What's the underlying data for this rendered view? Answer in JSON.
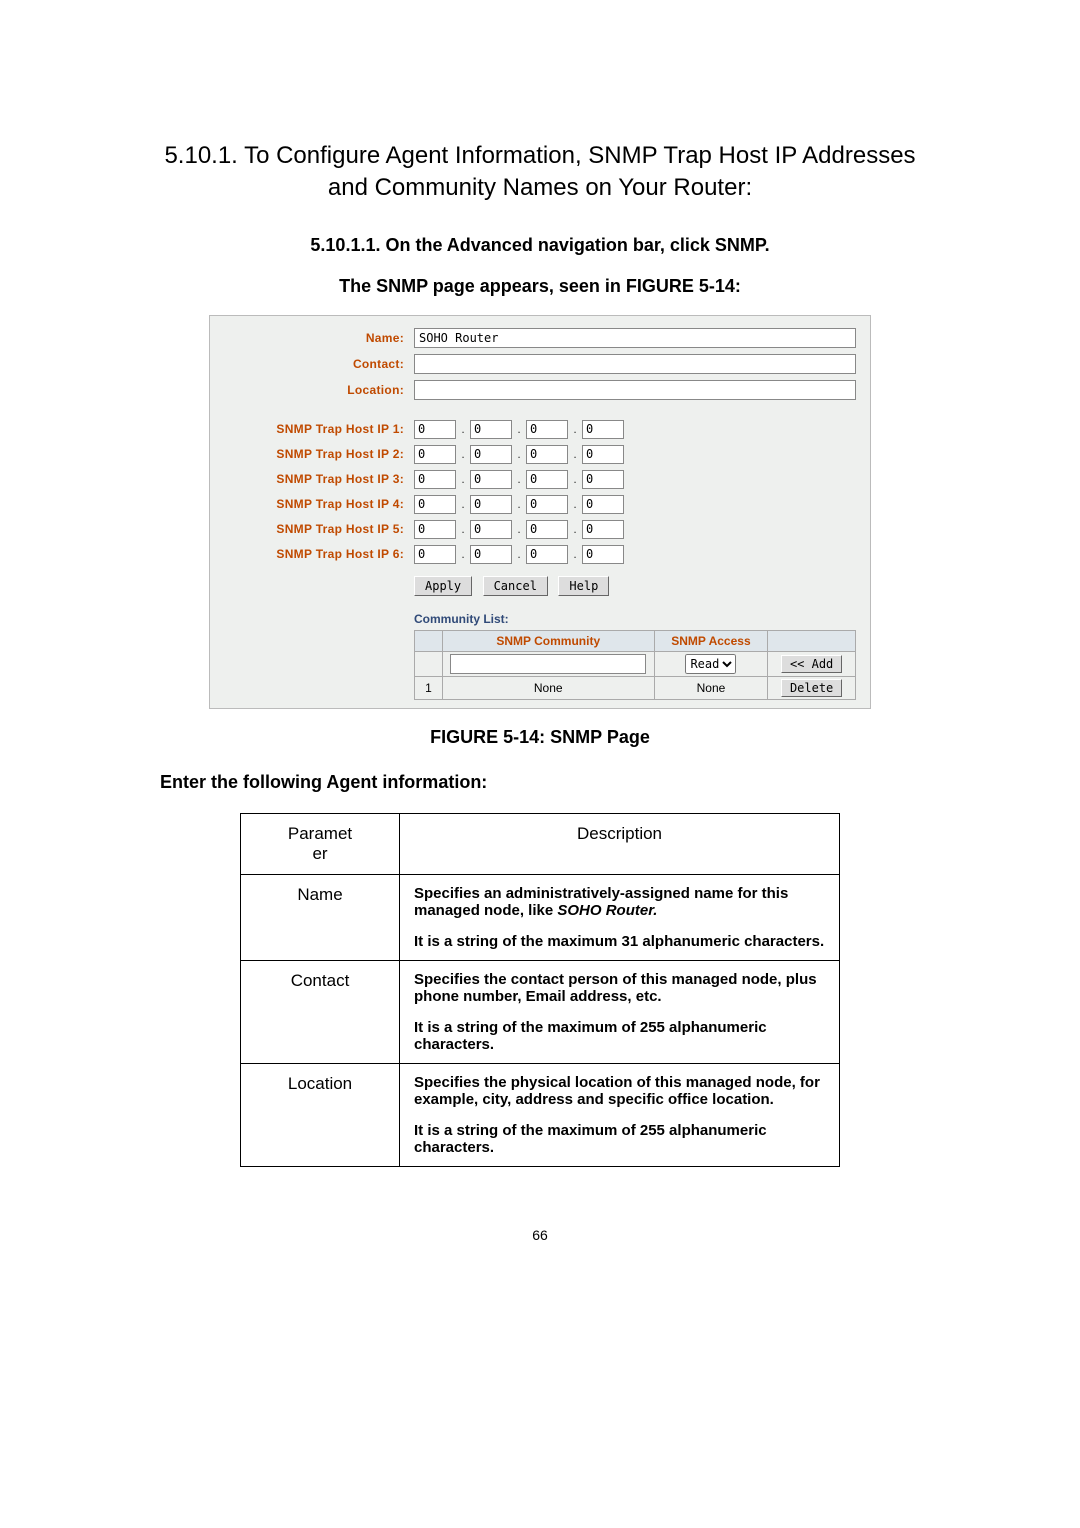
{
  "headings": {
    "section": "5.10.1. To Configure Agent Information, SNMP Trap Host IP Addresses and Community Names on Your Router:",
    "step": "5.10.1.1. On the Advanced navigation bar, click SNMP.",
    "result": "The SNMP page appears, seen in FIGURE 5-14:"
  },
  "snmp_page": {
    "labels": {
      "name": "Name:",
      "contact": "Contact:",
      "location": "Location:",
      "trap1": "SNMP Trap Host IP 1:",
      "trap2": "SNMP Trap Host IP 2:",
      "trap3": "SNMP Trap Host IP 3:",
      "trap4": "SNMP Trap Host IP 4:",
      "trap5": "SNMP Trap Host IP 5:",
      "trap6": "SNMP Trap Host IP 6:"
    },
    "fields": {
      "name_value": "SOHO Router",
      "contact_value": "",
      "location_value": "",
      "octet": "0"
    },
    "buttons": {
      "apply": "Apply",
      "cancel": "Cancel",
      "help": "Help"
    },
    "community": {
      "title": "Community List:",
      "col_community": "SNMP Community",
      "col_access": "SNMP Access",
      "access_selected": "Read",
      "add_btn": "<< Add",
      "row1_num": "1",
      "row1_comm": "None",
      "row1_access": "None",
      "delete_btn": "Delete"
    }
  },
  "figure_caption": "FIGURE 5-14: SNMP Page",
  "enter_info": "Enter the following Agent information:",
  "desc_table": {
    "header_param": "Paramet­er",
    "header_param_l1": "Paramet",
    "header_param_l2": "er",
    "header_desc": "Description",
    "rows": [
      {
        "param": "Name",
        "p1": "Specifies an administratively-assigned name for this managed node, like ",
        "p1_em": "SOHO Router.",
        "p2": "It is a string of the maximum 31 alphanumeric characters."
      },
      {
        "param": "Contact",
        "p1": "Specifies the contact person of this managed node, plus phone number, Email address, etc.",
        "p2": "It is a string of the maximum of 255 alphanumeric characters."
      },
      {
        "param": "Location",
        "p1": "Specifies the physical location of this managed node, for example, city, address and specific office location.",
        "p2": "It is a string of the maximum of 255 alphanumeric characters."
      }
    ]
  },
  "page_number": "66"
}
